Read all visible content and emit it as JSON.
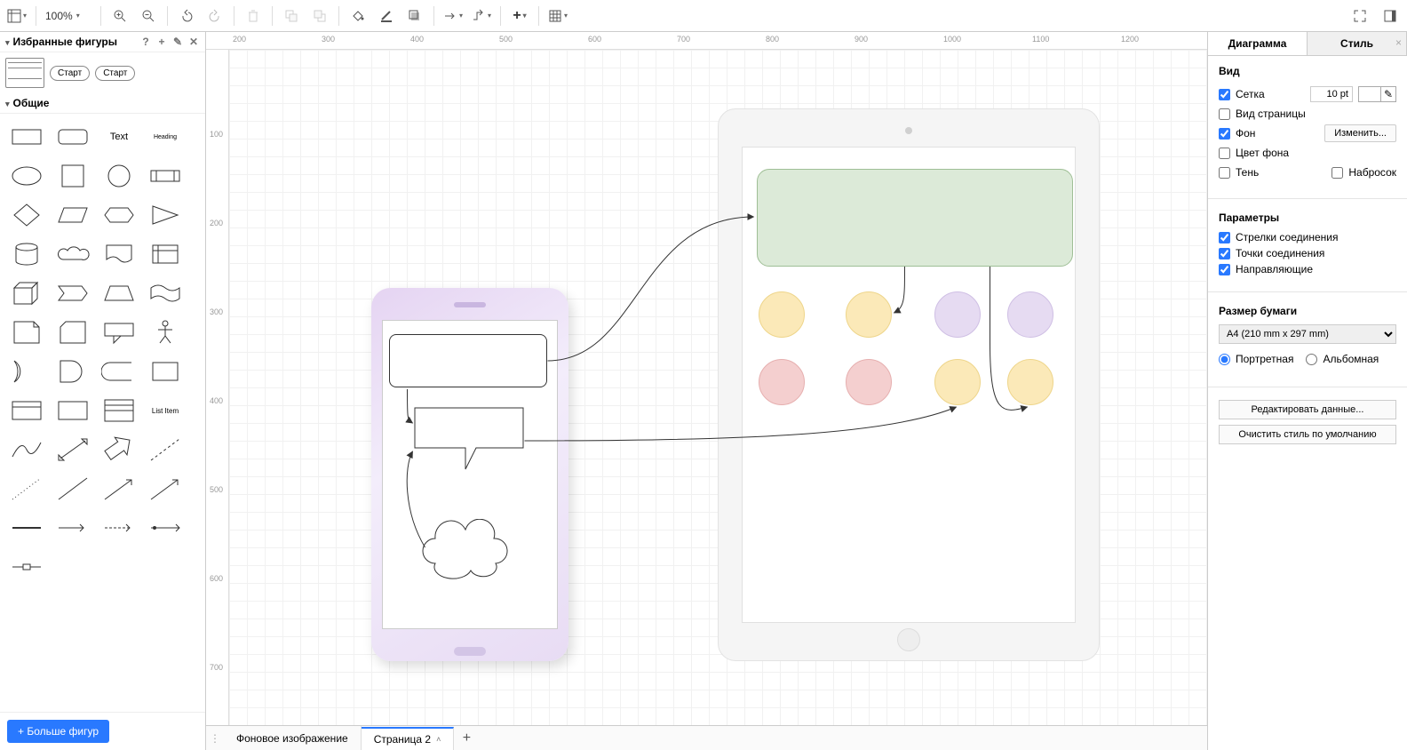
{
  "toolbar": {
    "zoom": "100%"
  },
  "left_panel": {
    "favorites_title": "Избранные фигуры",
    "start_label": "Старт",
    "general_title": "Общие",
    "text_shape_label": "Text",
    "heading_shape_label": "Heading",
    "list_item_label": "List Item",
    "more_shapes": "+ Больше фигур"
  },
  "canvas": {
    "ruler_h": [
      "200",
      "300",
      "400",
      "500",
      "600",
      "700",
      "800",
      "900",
      "1000",
      "1100",
      "1200"
    ],
    "ruler_v": [
      "100",
      "200",
      "300",
      "400",
      "500",
      "600",
      "700"
    ]
  },
  "bottom": {
    "tab_background": "Фоновое изображение",
    "tab_page2": "Страница 2"
  },
  "right": {
    "tab_diagram": "Диаграмма",
    "tab_style": "Стиль",
    "section_view": "Вид",
    "chk_grid": "Сетка",
    "grid_size": "10 pt",
    "chk_page_view": "Вид страницы",
    "chk_background": "Фон",
    "btn_change": "Изменить...",
    "chk_bg_color": "Цвет фона",
    "chk_shadow": "Тень",
    "chk_sketch": "Набросок",
    "section_params": "Параметры",
    "chk_conn_arrows": "Стрелки соединения",
    "chk_conn_points": "Точки соединения",
    "chk_guides": "Направляющие",
    "section_paper": "Размер бумаги",
    "paper_select": "A4 (210 mm x 297 mm)",
    "radio_portrait": "Портретная",
    "radio_landscape": "Альбомная",
    "btn_edit_data": "Редактировать данные...",
    "btn_clear_style": "Очистить стиль по умолчанию"
  }
}
